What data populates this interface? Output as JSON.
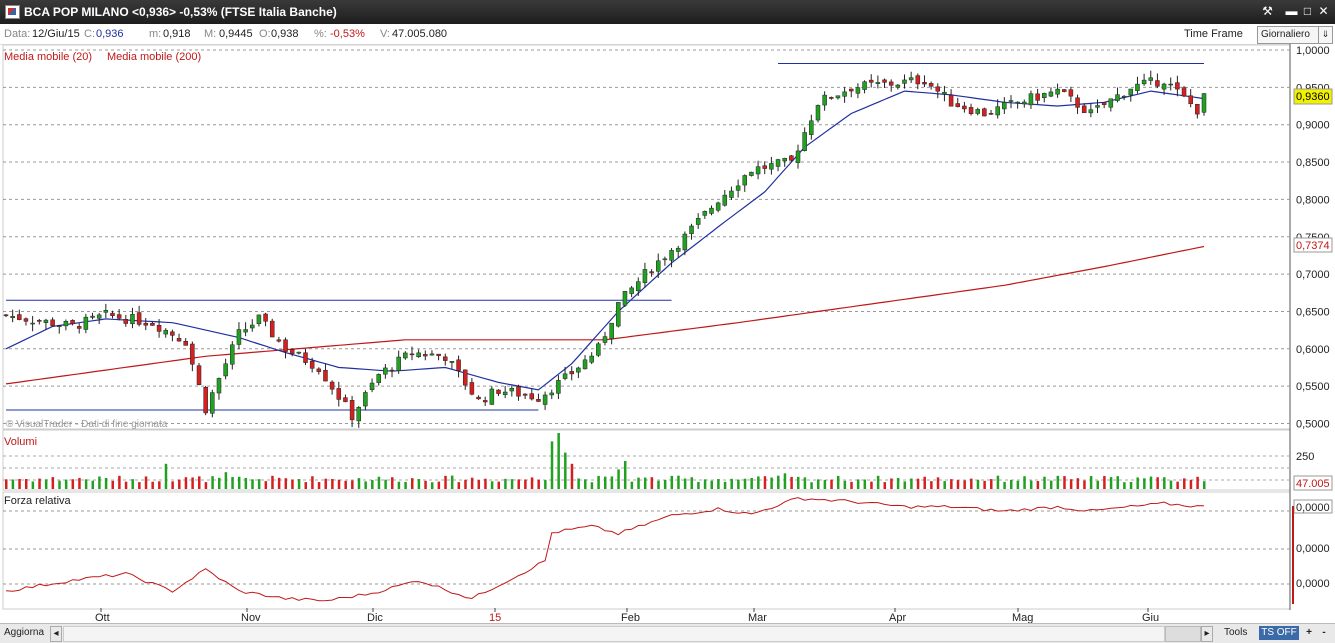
{
  "window": {
    "title": "BCA POP MILANO <0,936> -0,53%  (FTSE Italia Banche)"
  },
  "info": {
    "data_label": "Data:",
    "data_value": "12/Giu/15",
    "c_label": "C:",
    "c_value": "0,936",
    "m_label": "m:",
    "m_value": "0,918",
    "M_label": "M:",
    "M_value": "0,9445",
    "o_label": "O:",
    "o_value": "0,938",
    "pct_label": "%:",
    "pct_value": "-0,53%",
    "v_label": "V:",
    "v_value": "47.005.080",
    "time_frame_label": "Time Frame",
    "time_frame_value": "Giornaliero"
  },
  "legend": {
    "ma20": "Media mobile (20)",
    "ma200": "Media mobile (200)"
  },
  "watermark": "© VisualTrader - Dati di fine giornata",
  "panels": {
    "volume_title": "Volumi",
    "rs_title": "Forza relativa"
  },
  "bottom": {
    "update_label": "Aggiorna",
    "tools_label": "Tools",
    "ts_label": "TS OFF",
    "plus_label": "+",
    "minus_label": "-"
  },
  "colors": {
    "up": "#22a022",
    "down": "#d42020",
    "ma20": "#2030a0",
    "ma200": "#c01818",
    "trendline": "#2030a0",
    "rs": "#c01818"
  },
  "chart_data": [
    {
      "type": "candlestick",
      "title": "BCA POP MILANO",
      "x_labels": [
        "Ott",
        "Nov",
        "Dic",
        "15",
        "Feb",
        "Mar",
        "Apr",
        "Mag",
        "Giu"
      ],
      "y_ticks": [
        "1,0000",
        "0,9500",
        "0,9000",
        "0,8500",
        "0,8000",
        "0,7500",
        "0,7000",
        "0,6500",
        "0,6000",
        "0,5500",
        "0,5000"
      ],
      "ylim": [
        0.5,
        1.0
      ],
      "last_price_label": "0,9360",
      "ma200_label": "0,7374",
      "anchors": [
        [
          0,
          0.645
        ],
        [
          10,
          0.63
        ],
        [
          15,
          0.645
        ],
        [
          22,
          0.635
        ],
        [
          27,
          0.61
        ],
        [
          30,
          0.52
        ],
        [
          35,
          0.62
        ],
        [
          38,
          0.64
        ],
        [
          42,
          0.6
        ],
        [
          47,
          0.575
        ],
        [
          52,
          0.51
        ],
        [
          56,
          0.565
        ],
        [
          61,
          0.595
        ],
        [
          66,
          0.59
        ],
        [
          71,
          0.53
        ],
        [
          74,
          0.545
        ],
        [
          80,
          0.535
        ],
        [
          84,
          0.56
        ],
        [
          89,
          0.6
        ],
        [
          92,
          0.66
        ],
        [
          96,
          0.7
        ],
        [
          102,
          0.75
        ],
        [
          107,
          0.8
        ],
        [
          112,
          0.84
        ],
        [
          118,
          0.85
        ],
        [
          122,
          0.93
        ],
        [
          127,
          0.95
        ],
        [
          133,
          0.955
        ],
        [
          138,
          0.96
        ],
        [
          142,
          0.93
        ],
        [
          147,
          0.915
        ],
        [
          152,
          0.93
        ],
        [
          158,
          0.945
        ],
        [
          163,
          0.915
        ],
        [
          169,
          0.95
        ],
        [
          174,
          0.96
        ],
        [
          177,
          0.935
        ],
        [
          179,
          0.92
        ],
        [
          180,
          0.936
        ]
      ],
      "ma20_anchors": [
        [
          0,
          0.6
        ],
        [
          7,
          0.63
        ],
        [
          15,
          0.64
        ],
        [
          25,
          0.635
        ],
        [
          35,
          0.615
        ],
        [
          42,
          0.595
        ],
        [
          50,
          0.575
        ],
        [
          58,
          0.57
        ],
        [
          66,
          0.575
        ],
        [
          74,
          0.555
        ],
        [
          80,
          0.545
        ],
        [
          85,
          0.58
        ],
        [
          92,
          0.65
        ],
        [
          100,
          0.715
        ],
        [
          108,
          0.77
        ],
        [
          114,
          0.81
        ],
        [
          120,
          0.87
        ],
        [
          127,
          0.915
        ],
        [
          135,
          0.945
        ],
        [
          142,
          0.94
        ],
        [
          150,
          0.93
        ],
        [
          158,
          0.925
        ],
        [
          165,
          0.93
        ],
        [
          172,
          0.945
        ],
        [
          180,
          0.935
        ]
      ],
      "ma200_anchors": [
        [
          0,
          0.553
        ],
        [
          30,
          0.59
        ],
        [
          60,
          0.612
        ],
        [
          90,
          0.612
        ],
        [
          110,
          0.635
        ],
        [
          130,
          0.66
        ],
        [
          150,
          0.685
        ],
        [
          165,
          0.71
        ],
        [
          180,
          0.737
        ]
      ],
      "trendlines": [
        {
          "x1": 0,
          "y1": 0.665,
          "x2": 100,
          "y2": 0.665
        },
        {
          "x1": 0,
          "y1": 0.518,
          "x2": 80,
          "y2": 0.518
        },
        {
          "x1": 116,
          "y1": 0.982,
          "x2": 180,
          "y2": 0.982
        }
      ]
    },
    {
      "type": "bar",
      "title": "Volumi",
      "y_ticks": [
        "250"
      ],
      "last_volume_label": "47.005",
      "spikes": [
        [
          24,
          0.45
        ],
        [
          33,
          0.3
        ],
        [
          82,
          0.85
        ],
        [
          83,
          1.0
        ],
        [
          84,
          0.65
        ],
        [
          85,
          0.45
        ],
        [
          92,
          0.35
        ],
        [
          93,
          0.5
        ],
        [
          117,
          0.28
        ]
      ]
    },
    {
      "type": "line",
      "title": "Forza relativa",
      "y_ticks": [
        "0,0000",
        "0,0000",
        "0,0000"
      ],
      "anchors": [
        [
          0,
          0.12
        ],
        [
          10,
          0.22
        ],
        [
          18,
          0.28
        ],
        [
          25,
          0.12
        ],
        [
          30,
          0.32
        ],
        [
          35,
          0.12
        ],
        [
          42,
          0.05
        ],
        [
          48,
          0.03
        ],
        [
          55,
          0.1
        ],
        [
          62,
          0.22
        ],
        [
          70,
          0.05
        ],
        [
          78,
          0.3
        ],
        [
          81,
          0.4
        ],
        [
          82,
          0.66
        ],
        [
          88,
          0.72
        ],
        [
          92,
          0.65
        ],
        [
          100,
          0.82
        ],
        [
          107,
          0.88
        ],
        [
          112,
          0.83
        ],
        [
          119,
          0.98
        ],
        [
          127,
          0.95
        ],
        [
          135,
          0.9
        ],
        [
          142,
          0.9
        ],
        [
          150,
          0.86
        ],
        [
          158,
          0.9
        ],
        [
          163,
          0.86
        ],
        [
          169,
          0.9
        ],
        [
          174,
          0.93
        ],
        [
          180,
          0.9
        ]
      ]
    }
  ]
}
